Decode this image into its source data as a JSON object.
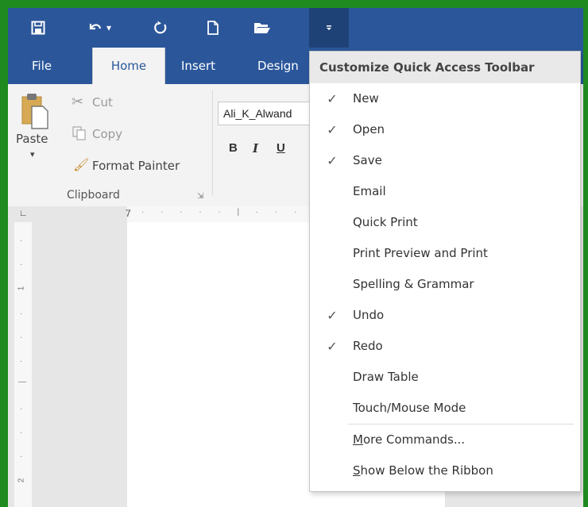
{
  "tabs": {
    "file": "File",
    "home": "Home",
    "insert": "Insert",
    "design": "Design"
  },
  "ribbon": {
    "paste": "Paste",
    "cut": "Cut",
    "copy": "Copy",
    "format_painter": "Format Painter",
    "clipboard_group": "Clipboard",
    "font_name": "Ali_K_Alwand",
    "bold": "B",
    "italic": "I",
    "underline": "U"
  },
  "menu": {
    "title": "Customize Quick Access Toolbar",
    "items": [
      {
        "label": "New",
        "checked": true
      },
      {
        "label": "Open",
        "checked": true
      },
      {
        "label": "Save",
        "checked": true
      },
      {
        "label": "Email",
        "checked": false
      },
      {
        "label": "Quick Print",
        "checked": false
      },
      {
        "label": "Print Preview and Print",
        "checked": false
      },
      {
        "label": "Spelling & Grammar",
        "checked": false
      },
      {
        "label": "Undo",
        "checked": true
      },
      {
        "label": "Redo",
        "checked": true
      },
      {
        "label": "Draw Table",
        "checked": false
      },
      {
        "label": "Touch/Mouse Mode",
        "checked": false
      }
    ],
    "more_commands": {
      "accel": "M",
      "rest": "ore Commands..."
    },
    "show_below": {
      "accel": "S",
      "rest": "how Below the Ribbon"
    },
    "check_mark": "✓"
  },
  "ruler": {
    "top_mark": "7",
    "v_mark_1": "1",
    "v_mark_2": "2"
  },
  "colors": {
    "title_bar": "#2b579a",
    "frame_border": "#1f8a1f"
  }
}
